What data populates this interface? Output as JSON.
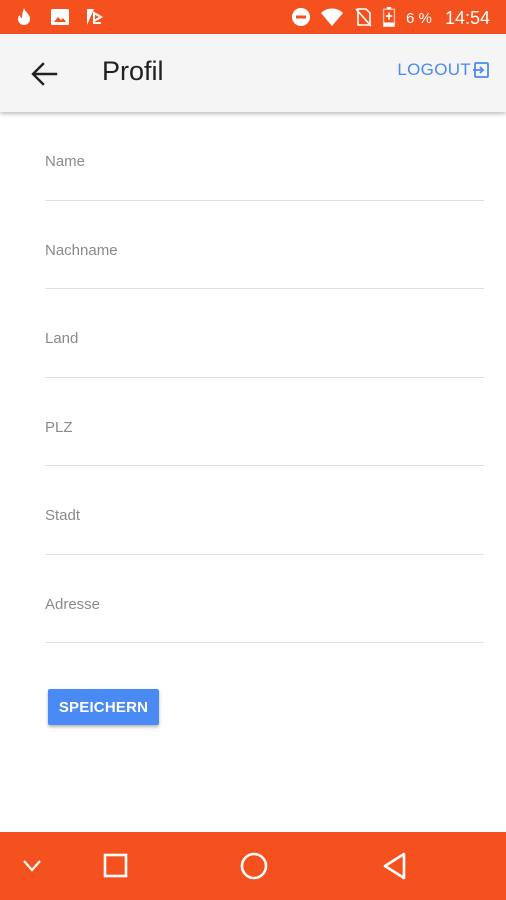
{
  "status_bar": {
    "battery_percent": "6 %",
    "time": "14:54",
    "icons": [
      "tinder-flame-icon",
      "gallery-icon",
      "app-icon",
      "do-not-disturb-icon",
      "wifi-icon",
      "no-sim-icon",
      "battery-charging-icon"
    ]
  },
  "app_bar": {
    "title": "Profil",
    "logout_label": "LOGOUT"
  },
  "form": {
    "fields": [
      {
        "label": "Name",
        "value": ""
      },
      {
        "label": "Nachname",
        "value": ""
      },
      {
        "label": "Land",
        "value": ""
      },
      {
        "label": "PLZ",
        "value": ""
      },
      {
        "label": "Stadt",
        "value": ""
      },
      {
        "label": "Adresse",
        "value": ""
      }
    ],
    "save_label": "SPEICHERN"
  },
  "nav_bar": {
    "icons": [
      "collapse-icon",
      "recents-icon",
      "home-icon",
      "back-icon"
    ]
  },
  "colors": {
    "accent": "#f4511e",
    "primary_button": "#4a8af4",
    "app_bar_bg": "#f5f5f5"
  }
}
